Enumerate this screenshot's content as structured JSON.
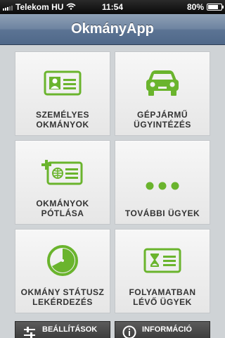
{
  "status_bar": {
    "carrier": "Telekom HU",
    "time": "11:54",
    "battery_percent_text": "80%",
    "battery_level": 0.8
  },
  "nav": {
    "title": "OkmányApp"
  },
  "tiles": [
    {
      "line1": "SZEMÉLYES",
      "line2": "OKMÁNYOK",
      "icon": "id-card-icon"
    },
    {
      "line1": "GÉPJÁRMŰ",
      "line2": "ÜGYINTÉZÉS",
      "icon": "car-icon"
    },
    {
      "line1": "OKMÁNYOK",
      "line2": "PÓTLÁSA",
      "icon": "id-card-replace-icon"
    },
    {
      "line1": "TOVÁBBI ÜGYEK",
      "line2": "",
      "icon": "more-dots-icon"
    },
    {
      "line1": "OKMÁNY STÁTUSZ",
      "line2": "LEKÉRDEZÉS",
      "icon": "clock-icon"
    },
    {
      "line1": "FOLYAMATBAN",
      "line2": "LÉVŐ ÜGYEK",
      "icon": "hourglass-card-icon"
    }
  ],
  "bottom": {
    "settings_label": "BEÁLLÍTÁSOK",
    "info_label": "INFORMÁCIÓ"
  },
  "colors": {
    "accent": "#6ab42d",
    "nav": "#5c7494"
  }
}
